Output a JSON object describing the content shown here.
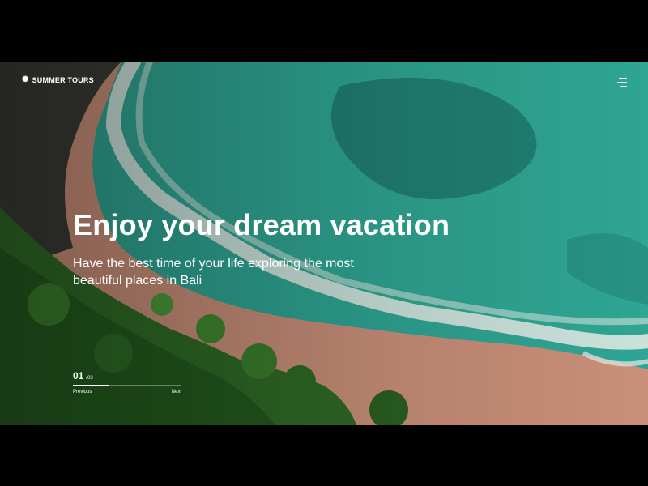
{
  "brand": {
    "name": "SUMMER TOURS",
    "icon": "sun-icon"
  },
  "menu": {
    "icon": "menu-icon"
  },
  "hero": {
    "title": "Enjoy your dream vacation",
    "subtitle": "Have the best time of your life exploring the most beautiful places in Bali"
  },
  "slider": {
    "current": "01",
    "total": "/03",
    "progress": 0.33,
    "previous_label": "Previous",
    "next_label": "Next"
  },
  "colors": {
    "sea": "#2fa593",
    "sea_deep": "#1a6f67",
    "sand": "#c98f79",
    "foam": "#e6ece8",
    "foliage": "#2f6b26",
    "text": "#ffffff",
    "letterbox": "#000000"
  }
}
